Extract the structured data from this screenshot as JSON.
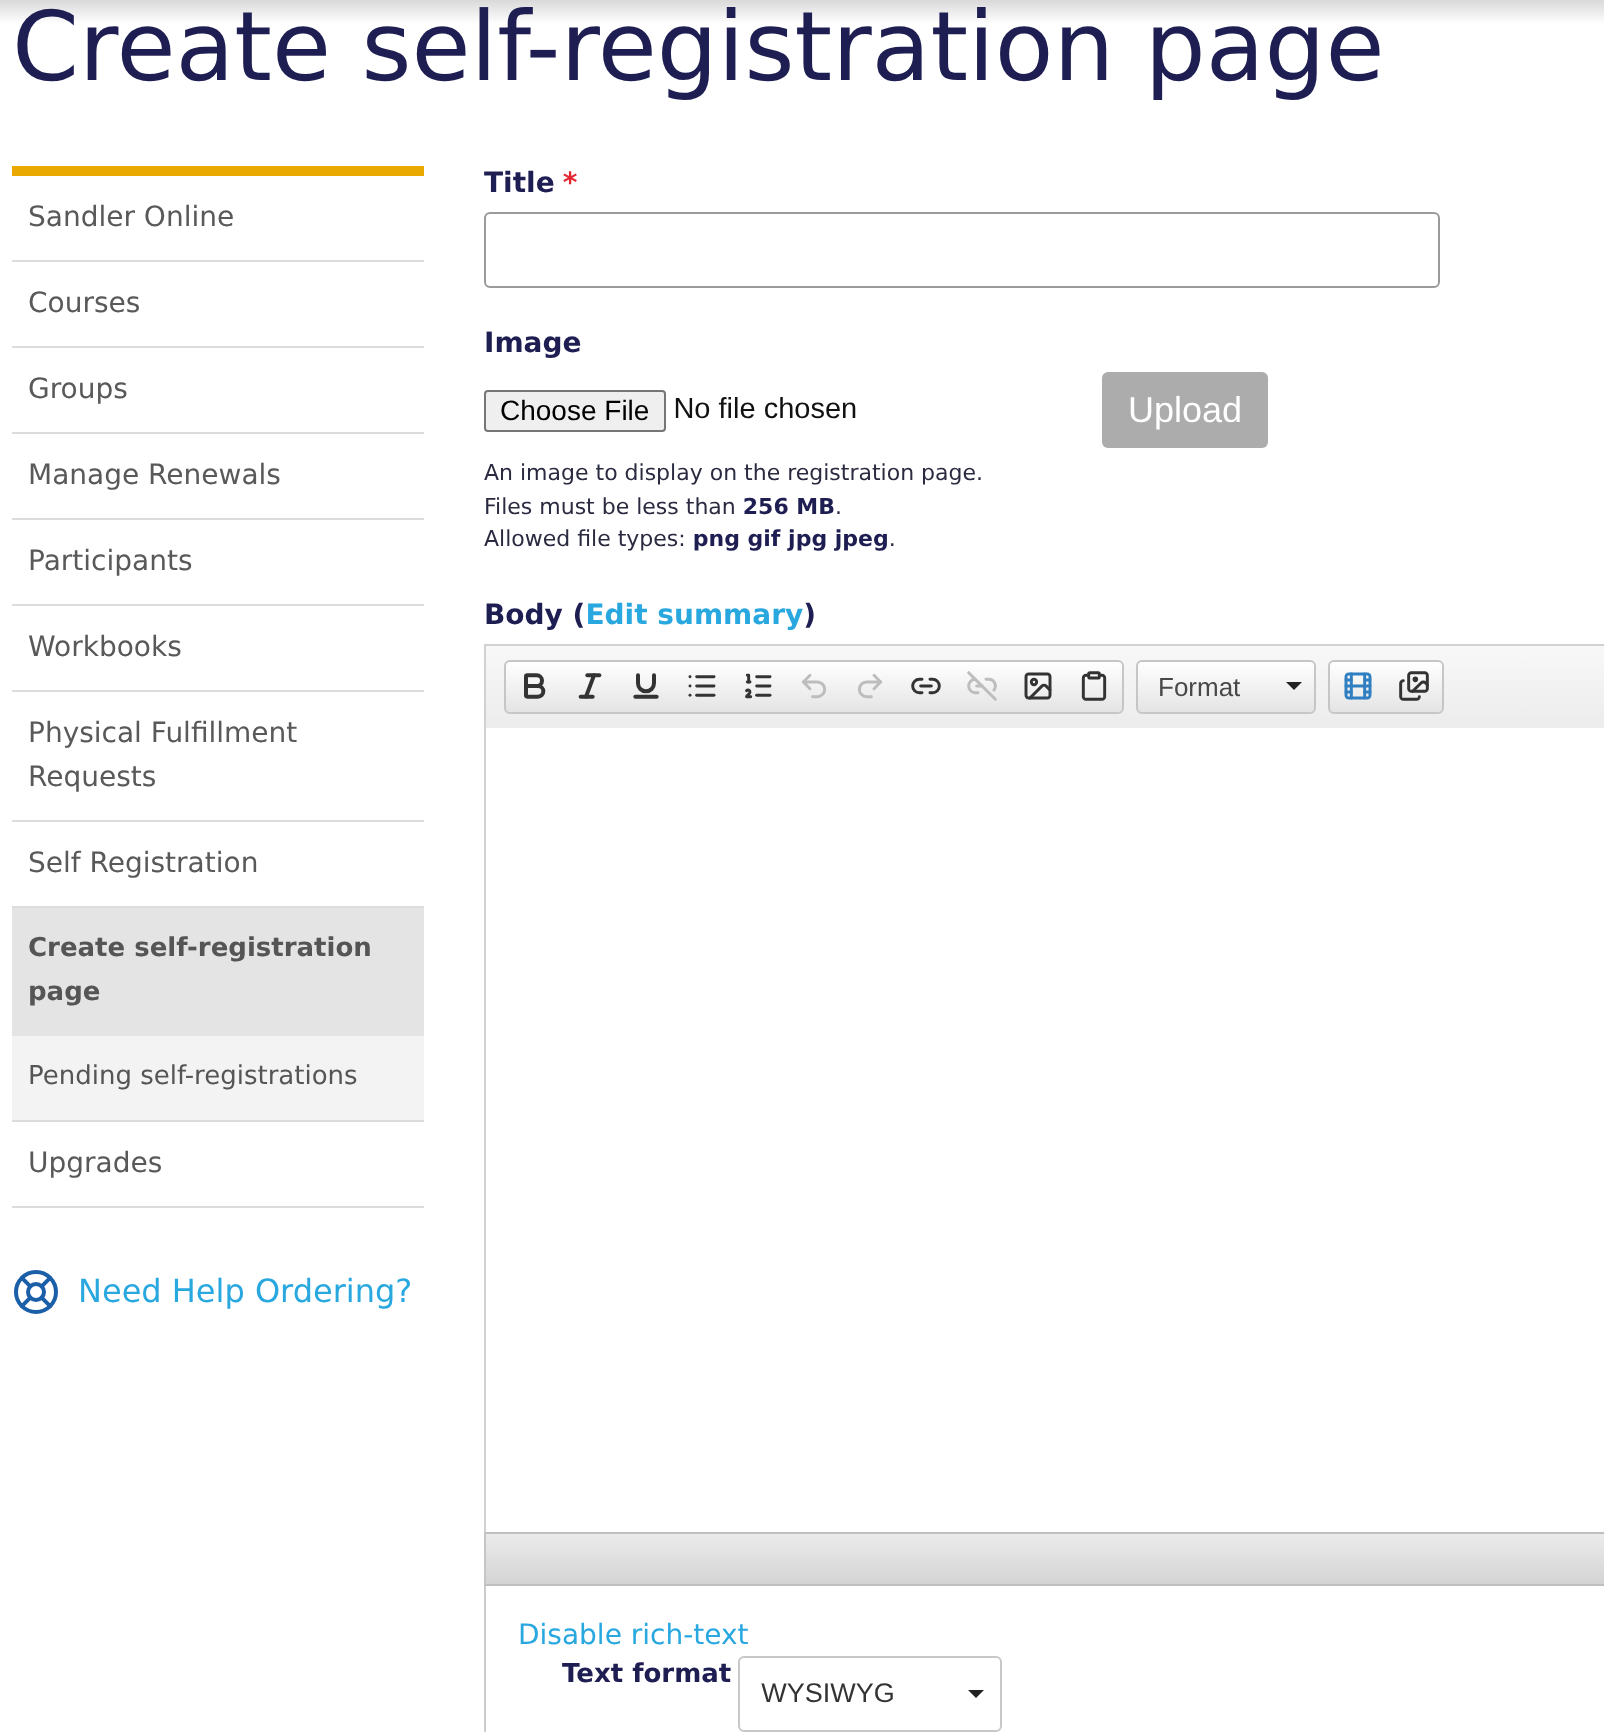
{
  "page_title": "Create self-registration page",
  "sidebar": {
    "items": [
      {
        "label": "Sandler Online",
        "selected": false
      },
      {
        "label": "Courses",
        "selected": false
      },
      {
        "label": "Groups",
        "selected": false
      },
      {
        "label": "Manage Renewals",
        "selected": false
      },
      {
        "label": "Participants",
        "selected": false
      },
      {
        "label": "Workbooks",
        "selected": false
      },
      {
        "label": "Physical Fulfillment Requests",
        "selected": false
      },
      {
        "label": "Self Registration",
        "selected": false,
        "children": [
          {
            "label": "Create self-registration page",
            "selected": true
          },
          {
            "label": "Pending self-registrations",
            "selected": false
          }
        ]
      },
      {
        "label": "Upgrades",
        "selected": false
      }
    ],
    "help_link": "Need Help Ordering?"
  },
  "title_field": {
    "label": "Title",
    "required_mark": "*"
  },
  "image_field": {
    "label": "Image",
    "choose_button": "Choose File",
    "file_status": "No file chosen",
    "upload_button": {
      "label": "Upload",
      "disabled": true
    },
    "help": [
      "An image to display on the registration page.",
      "Files must be less than **256 MB**.",
      "Allowed file types: **png gif jpg jpeg**."
    ]
  },
  "body_field": {
    "label_before": "Body (",
    "link": "Edit summary",
    "label_after": ")",
    "toolbar": [
      {
        "kind": "buttons",
        "items": [
          {
            "kind": "bold",
            "disabled": false
          },
          {
            "kind": "italic",
            "disabled": false
          },
          {
            "kind": "underline",
            "disabled": false
          },
          {
            "kind": "bullets",
            "disabled": false
          },
          {
            "kind": "numbering",
            "disabled": false
          },
          {
            "kind": "undo",
            "disabled": true
          },
          {
            "kind": "redo",
            "disabled": true
          },
          {
            "kind": "link",
            "disabled": false
          },
          {
            "kind": "unlink",
            "disabled": true
          },
          {
            "kind": "image",
            "disabled": false
          },
          {
            "kind": "paste",
            "disabled": false
          }
        ]
      },
      {
        "kind": "dropdown",
        "label": "Format"
      },
      {
        "kind": "buttons",
        "items": [
          {
            "kind": "video",
            "disabled": false
          },
          {
            "kind": "gallery",
            "disabled": false
          }
        ]
      }
    ]
  },
  "text_format": {
    "toggle_link": "Disable rich-text",
    "label": "Text format",
    "value": "WYSIWYG"
  }
}
